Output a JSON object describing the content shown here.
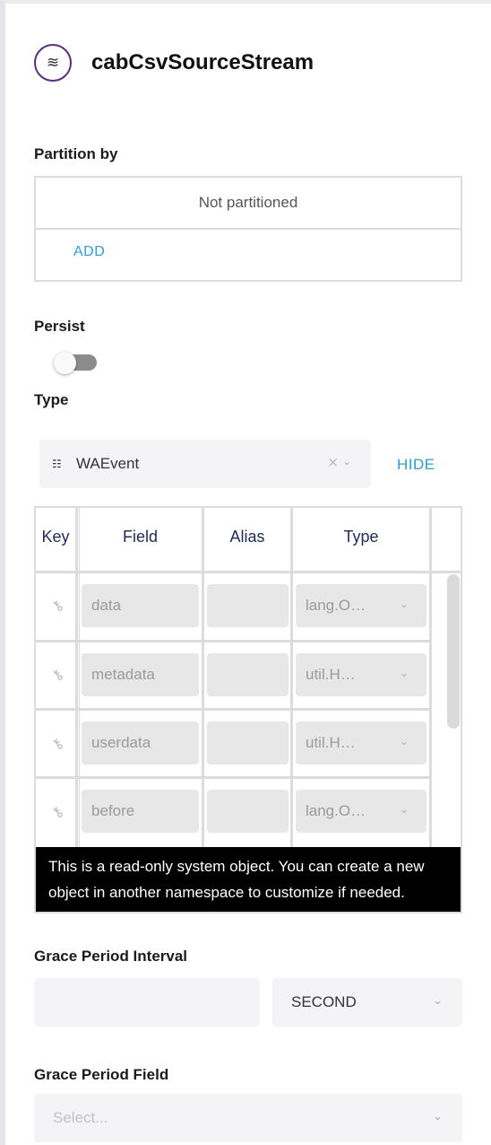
{
  "header": {
    "icon": "stream-icon",
    "icon_glyph": "≋",
    "title": "cabCsvSourceStream"
  },
  "partition": {
    "label": "Partition by",
    "empty_text": "Not partitioned",
    "add_label": "ADD"
  },
  "persist": {
    "label": "Persist",
    "enabled": false
  },
  "type": {
    "label": "Type",
    "list_glyph": "☷",
    "value": "WAEvent",
    "clear_glyph": "×",
    "chevron_glyph": "⌄",
    "hide_label": "HIDE"
  },
  "fields_table": {
    "columns": [
      "Key",
      "Field",
      "Alias",
      "Type"
    ],
    "key_glyph": "⚷",
    "chevron_glyph": "⌄",
    "rows": [
      {
        "field": "data",
        "alias": "",
        "type": "lang.O…"
      },
      {
        "field": "metadata",
        "alias": "",
        "type": "util.H…"
      },
      {
        "field": "userdata",
        "alias": "",
        "type": "util.H…"
      },
      {
        "field": "before",
        "alias": "",
        "type": "lang.O…"
      }
    ],
    "tooltip": "This is a read-only system object. You can create a new object in another namespace to customize if needed."
  },
  "grace_period_interval": {
    "label": "Grace Period Interval",
    "value": "",
    "unit": "SECOND",
    "chevron_glyph": "⌄"
  },
  "grace_period_field": {
    "label": "Grace Period Field",
    "placeholder": "Select...",
    "chevron_glyph": "⌄"
  },
  "colors": {
    "accent_link": "#2a9fd8",
    "header_text": "#1f2a5a",
    "icon_ring": "#5a2d82"
  }
}
